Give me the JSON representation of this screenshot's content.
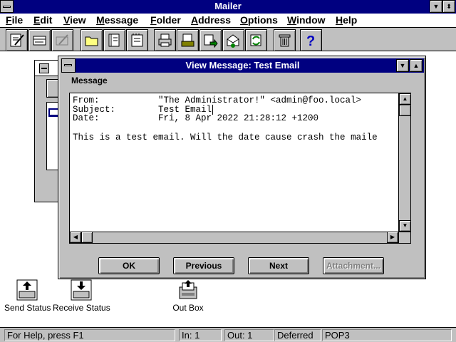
{
  "app": {
    "title": "Mailer"
  },
  "menu": [
    {
      "label": "File",
      "u": "F",
      "rest": "ile"
    },
    {
      "label": "Edit",
      "u": "E",
      "rest": "dit"
    },
    {
      "label": "View",
      "u": "V",
      "rest": "iew"
    },
    {
      "label": "Message",
      "u": "M",
      "rest": "essage"
    },
    {
      "label": "Folder",
      "u": "F",
      "rest": "older"
    },
    {
      "label": "Address",
      "u": "A",
      "rest": "ddress"
    },
    {
      "label": "Options",
      "u": "O",
      "rest": "ptions"
    },
    {
      "label": "Window",
      "u": "W",
      "rest": "indow"
    },
    {
      "label": "Help",
      "u": "H",
      "rest": "elp"
    }
  ],
  "toolbar": {
    "icons": [
      "compose-icon",
      "reply-icon",
      "disabled-reply-icon",
      "folder-icon",
      "address-book-icon",
      "notepad-icon",
      "print-icon",
      "save-icon",
      "forward-icon",
      "open-envelope-icon",
      "refresh-icon",
      "trash-icon",
      "help-icon"
    ]
  },
  "view_message": {
    "title": "View Message: Test Email",
    "section_label": "Message",
    "from_label": "From:",
    "from_value": "\"The Administrator!\" <admin@foo.local>",
    "subject_label": "Subject:",
    "subject_value": "Test Email",
    "date_label": "Date:",
    "date_value": "Fri, 8 Apr 2022 21:28:12 +1200",
    "body": "This is a test email. Will the date cause crash the maile",
    "buttons": {
      "ok": "OK",
      "previous": "Previous",
      "next": "Next",
      "attachment": "Attachment..."
    }
  },
  "desktop_icons": {
    "send_status": "Send Status",
    "receive_status": "Receive Status",
    "out_box": "Out Box"
  },
  "status": {
    "help": "For Help, press F1",
    "in": "In: 1",
    "out": "Out: 1",
    "mode": "Deferred",
    "protocol": "POP3"
  }
}
